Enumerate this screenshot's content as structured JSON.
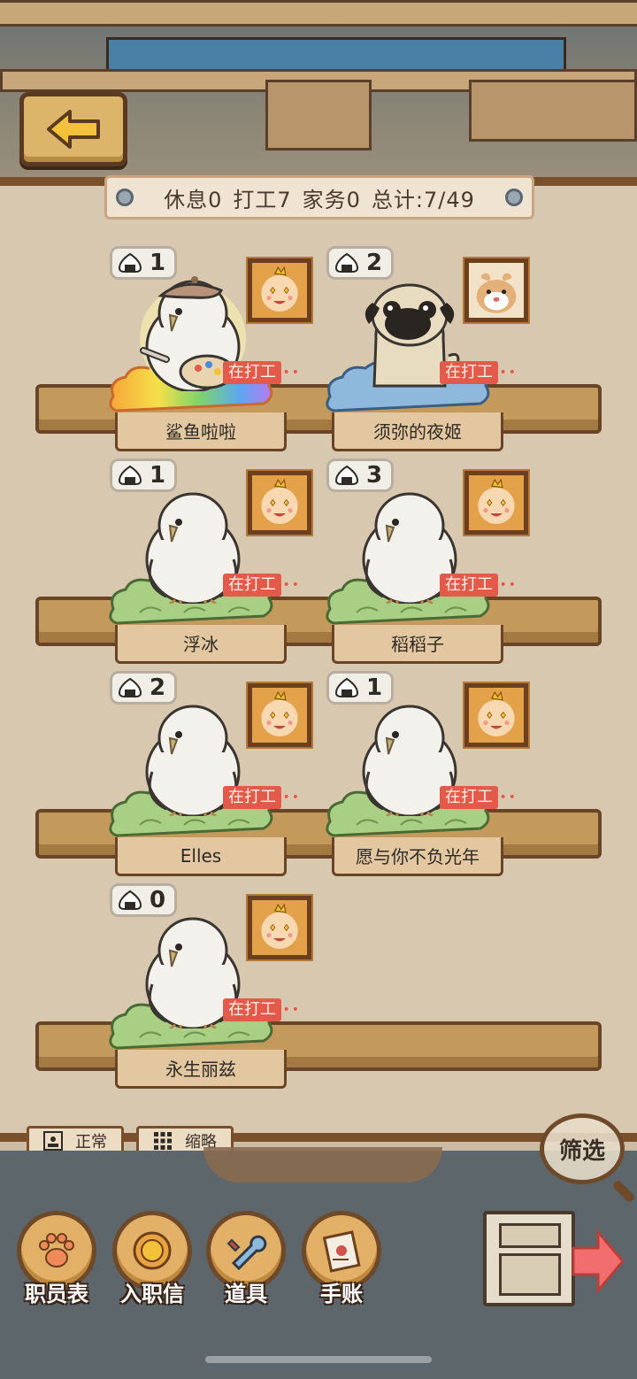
{
  "status_bar": {
    "rest": "休息0",
    "work": "打工7",
    "chores": "家务0",
    "total": "总计:7/49"
  },
  "staff": [
    {
      "name": "鲨鱼啦啦",
      "count": "1",
      "tag": "在打工",
      "creature": "bird-artist",
      "nest": "rainbow"
    },
    {
      "name": "须弥的夜姬",
      "count": "2",
      "tag": "在打工",
      "creature": "pug",
      "nest": "blue"
    },
    {
      "name": "浮冰",
      "count": "1",
      "tag": "在打工",
      "creature": "bird",
      "nest": "green"
    },
    {
      "name": "稻稻子",
      "count": "3",
      "tag": "在打工",
      "creature": "bird",
      "nest": "green"
    },
    {
      "name": "Elles",
      "count": "2",
      "tag": "在打工",
      "creature": "bird",
      "nest": "green"
    },
    {
      "name": "愿与你不负光年",
      "count": "1",
      "tag": "在打工",
      "creature": "bird",
      "nest": "green"
    },
    {
      "name": "永生丽兹",
      "count": "0",
      "tag": "在打工",
      "creature": "bird",
      "nest": "green"
    }
  ],
  "view_tabs": {
    "normal": "正常",
    "compact": "缩略"
  },
  "filter_label": "筛选",
  "nav": {
    "staff_list": "职员表",
    "offer_letter": "入职信",
    "items": "道具",
    "journal": "手账"
  },
  "colors": {
    "work_tag": "#e45a4a",
    "wood": "#c49a5c",
    "board": "#d8c8b0"
  }
}
